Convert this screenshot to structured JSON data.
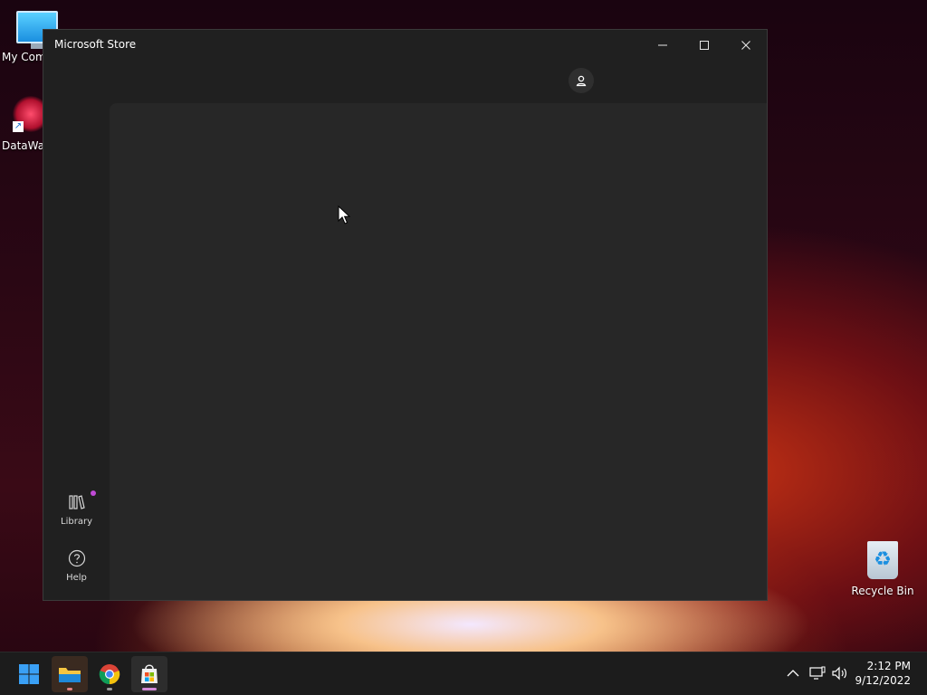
{
  "desktop": {
    "icons": [
      {
        "label": "My Com"
      },
      {
        "label": "DataWag"
      },
      {
        "label": "Recycle Bin"
      }
    ]
  },
  "window": {
    "title": "Microsoft Store",
    "sidebar": {
      "items": [
        {
          "label": "Library",
          "icon": "library-icon"
        },
        {
          "label": "Help",
          "icon": "help-icon"
        }
      ],
      "badge_color": "#c04ad6"
    }
  },
  "taskbar": {
    "clock": {
      "time": "2:12 PM",
      "date": "9/12/2022"
    }
  },
  "colors": {
    "window_bg": "#202020",
    "content_bg": "#272727",
    "taskbar_bg": "#1c1c1c"
  }
}
